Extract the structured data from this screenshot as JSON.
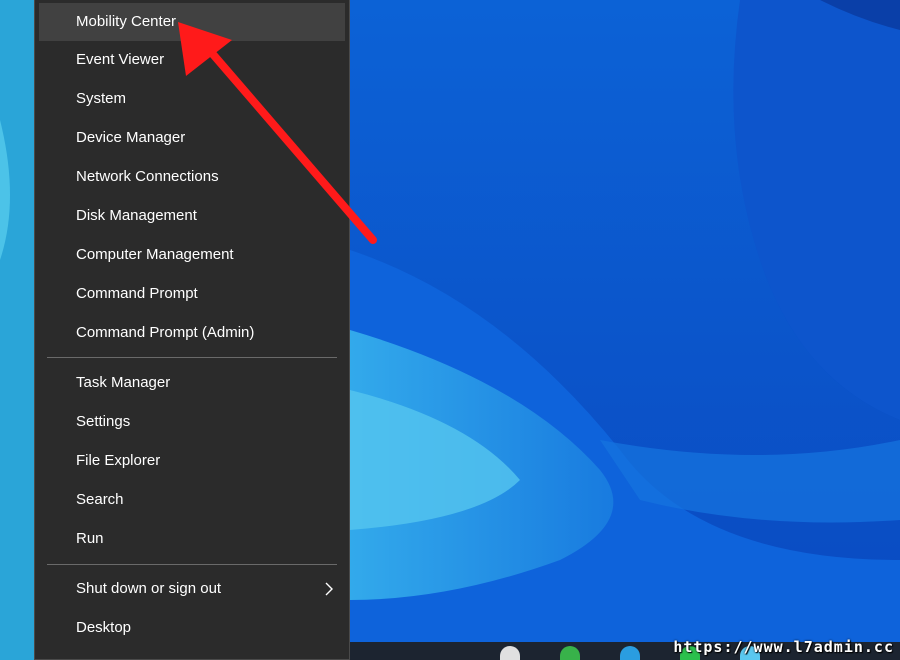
{
  "menu": {
    "group1": [
      {
        "label": "Mobility Center",
        "highlighted": true
      },
      {
        "label": "Event Viewer"
      },
      {
        "label": "System"
      },
      {
        "label": "Device Manager"
      },
      {
        "label": "Network Connections"
      },
      {
        "label": "Disk Management"
      },
      {
        "label": "Computer Management"
      },
      {
        "label": "Command Prompt"
      },
      {
        "label": "Command Prompt (Admin)"
      }
    ],
    "group2": [
      {
        "label": "Task Manager"
      },
      {
        "label": "Settings"
      },
      {
        "label": "File Explorer"
      },
      {
        "label": "Search"
      },
      {
        "label": "Run"
      }
    ],
    "group3": [
      {
        "label": "Shut down or sign out",
        "has_submenu": true,
        "submenu_icon": "chevron-right-icon"
      },
      {
        "label": "Desktop"
      }
    ]
  },
  "annotation": {
    "color": "#ff1a1a",
    "icon": "red-arrow-annotation"
  },
  "watermark": "https://www.l7admin.cc",
  "colors": {
    "menu_bg": "#2b2b2b",
    "highlight": "#414141",
    "wallpaper": "#0a4fc8"
  }
}
